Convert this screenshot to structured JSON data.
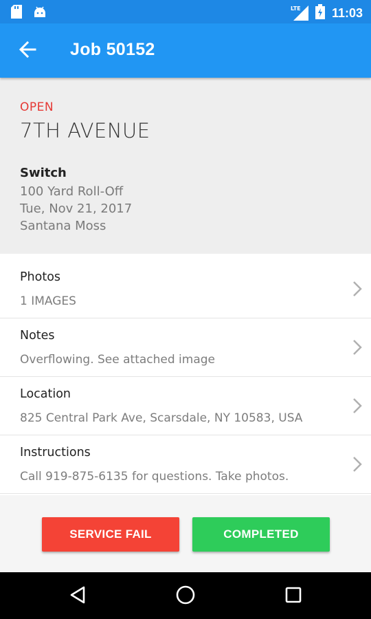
{
  "status_bar": {
    "time": "11:03",
    "network": "LTE",
    "icons": [
      "sd-card-icon",
      "android-icon",
      "signal-icon",
      "battery-icon"
    ]
  },
  "app_bar": {
    "title": "Job 50152",
    "back_icon": "arrow-back-icon"
  },
  "job": {
    "status": "OPEN",
    "site": "7TH AVENUE",
    "service_type": "Switch",
    "container": "100 Yard Roll-Off",
    "date": "Tue, Nov 21, 2017",
    "driver": "Santana Moss"
  },
  "details": [
    {
      "label": "Photos",
      "value": "1 IMAGES"
    },
    {
      "label": "Notes",
      "value": "Overflowing. See attached image"
    },
    {
      "label": "Location",
      "value": "825 Central Park Ave, Scarsdale, NY 10583, USA"
    },
    {
      "label": "Instructions",
      "value": "Call 919-875-6135 for questions. Take photos."
    }
  ],
  "actions": {
    "fail_label": "SERVICE FAIL",
    "complete_label": "COMPLETED"
  },
  "colors": {
    "status_bar": "#1e88e5",
    "app_bar": "#2196f3",
    "status_open": "#e53935",
    "fail_button": "#f44336",
    "complete_button": "#2ecc5a"
  },
  "nav_bar": {
    "icons": [
      "back-triangle-icon",
      "home-circle-icon",
      "recents-square-icon"
    ]
  }
}
